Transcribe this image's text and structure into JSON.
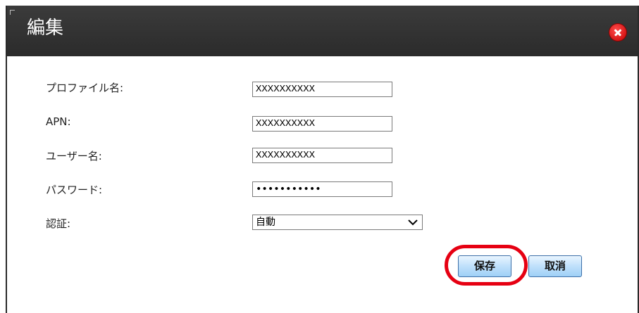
{
  "dialog": {
    "title": "編集",
    "close_icon": "close-icon",
    "accent_color": "#e60012"
  },
  "form": {
    "profile_name": {
      "label": "プロファイル名:",
      "value": "XXXXXXXXXX"
    },
    "apn": {
      "label": "APN:",
      "value": "XXXXXXXXXX"
    },
    "username": {
      "label": "ユーザー名:",
      "value": "XXXXXXXXXX"
    },
    "password": {
      "label": "パスワード:",
      "value": "XXXXXXXXXXX"
    },
    "auth": {
      "label": "認証:",
      "selected": "自動"
    }
  },
  "buttons": {
    "save_label": "保存",
    "cancel_label": "取消"
  }
}
